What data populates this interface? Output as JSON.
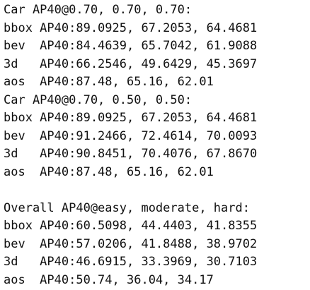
{
  "output": {
    "lines": [
      "Car AP40@0.70, 0.70, 0.70:",
      "bbox AP40:89.0925, 67.2053, 64.4681",
      "bev  AP40:84.4639, 65.7042, 61.9088",
      "3d   AP40:66.2546, 49.6429, 45.3697",
      "aos  AP40:87.48, 65.16, 62.01",
      "Car AP40@0.70, 0.50, 0.50:",
      "bbox AP40:89.0925, 67.2053, 64.4681",
      "bev  AP40:91.2466, 72.4614, 70.0093",
      "3d   AP40:90.8451, 70.4076, 67.8670",
      "aos  AP40:87.48, 65.16, 62.01",
      "",
      "Overall AP40@easy, moderate, hard:",
      "bbox AP40:60.5098, 44.4403, 41.8355",
      "bev  AP40:57.0206, 41.8488, 38.9702",
      "3d   AP40:46.6915, 33.3969, 30.7103",
      "aos  AP40:50.74, 36.04, 34.17"
    ]
  }
}
